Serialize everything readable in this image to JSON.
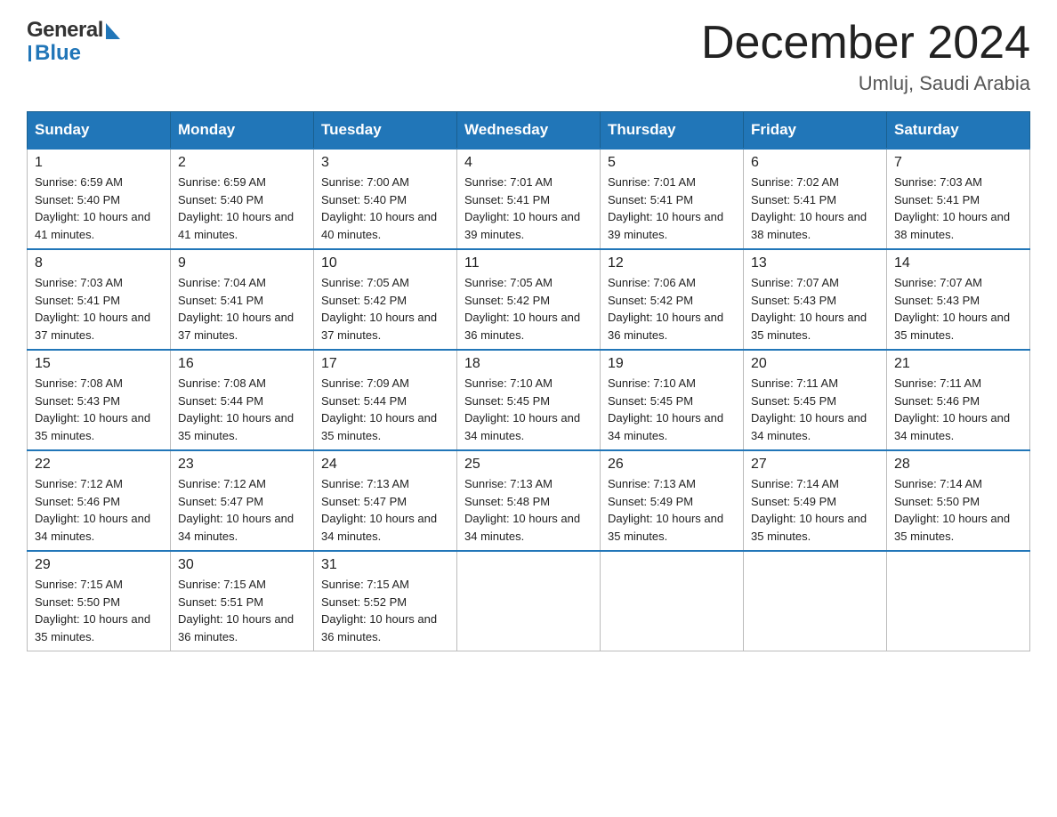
{
  "header": {
    "logo_general": "General",
    "logo_blue": "Blue",
    "month_title": "December 2024",
    "location": "Umluj, Saudi Arabia"
  },
  "days_of_week": [
    "Sunday",
    "Monday",
    "Tuesday",
    "Wednesday",
    "Thursday",
    "Friday",
    "Saturday"
  ],
  "weeks": [
    [
      {
        "day": "1",
        "sunrise": "6:59 AM",
        "sunset": "5:40 PM",
        "daylight": "10 hours and 41 minutes."
      },
      {
        "day": "2",
        "sunrise": "6:59 AM",
        "sunset": "5:40 PM",
        "daylight": "10 hours and 41 minutes."
      },
      {
        "day": "3",
        "sunrise": "7:00 AM",
        "sunset": "5:40 PM",
        "daylight": "10 hours and 40 minutes."
      },
      {
        "day": "4",
        "sunrise": "7:01 AM",
        "sunset": "5:41 PM",
        "daylight": "10 hours and 39 minutes."
      },
      {
        "day": "5",
        "sunrise": "7:01 AM",
        "sunset": "5:41 PM",
        "daylight": "10 hours and 39 minutes."
      },
      {
        "day": "6",
        "sunrise": "7:02 AM",
        "sunset": "5:41 PM",
        "daylight": "10 hours and 38 minutes."
      },
      {
        "day": "7",
        "sunrise": "7:03 AM",
        "sunset": "5:41 PM",
        "daylight": "10 hours and 38 minutes."
      }
    ],
    [
      {
        "day": "8",
        "sunrise": "7:03 AM",
        "sunset": "5:41 PM",
        "daylight": "10 hours and 37 minutes."
      },
      {
        "day": "9",
        "sunrise": "7:04 AM",
        "sunset": "5:41 PM",
        "daylight": "10 hours and 37 minutes."
      },
      {
        "day": "10",
        "sunrise": "7:05 AM",
        "sunset": "5:42 PM",
        "daylight": "10 hours and 37 minutes."
      },
      {
        "day": "11",
        "sunrise": "7:05 AM",
        "sunset": "5:42 PM",
        "daylight": "10 hours and 36 minutes."
      },
      {
        "day": "12",
        "sunrise": "7:06 AM",
        "sunset": "5:42 PM",
        "daylight": "10 hours and 36 minutes."
      },
      {
        "day": "13",
        "sunrise": "7:07 AM",
        "sunset": "5:43 PM",
        "daylight": "10 hours and 35 minutes."
      },
      {
        "day": "14",
        "sunrise": "7:07 AM",
        "sunset": "5:43 PM",
        "daylight": "10 hours and 35 minutes."
      }
    ],
    [
      {
        "day": "15",
        "sunrise": "7:08 AM",
        "sunset": "5:43 PM",
        "daylight": "10 hours and 35 minutes."
      },
      {
        "day": "16",
        "sunrise": "7:08 AM",
        "sunset": "5:44 PM",
        "daylight": "10 hours and 35 minutes."
      },
      {
        "day": "17",
        "sunrise": "7:09 AM",
        "sunset": "5:44 PM",
        "daylight": "10 hours and 35 minutes."
      },
      {
        "day": "18",
        "sunrise": "7:10 AM",
        "sunset": "5:45 PM",
        "daylight": "10 hours and 34 minutes."
      },
      {
        "day": "19",
        "sunrise": "7:10 AM",
        "sunset": "5:45 PM",
        "daylight": "10 hours and 34 minutes."
      },
      {
        "day": "20",
        "sunrise": "7:11 AM",
        "sunset": "5:45 PM",
        "daylight": "10 hours and 34 minutes."
      },
      {
        "day": "21",
        "sunrise": "7:11 AM",
        "sunset": "5:46 PM",
        "daylight": "10 hours and 34 minutes."
      }
    ],
    [
      {
        "day": "22",
        "sunrise": "7:12 AM",
        "sunset": "5:46 PM",
        "daylight": "10 hours and 34 minutes."
      },
      {
        "day": "23",
        "sunrise": "7:12 AM",
        "sunset": "5:47 PM",
        "daylight": "10 hours and 34 minutes."
      },
      {
        "day": "24",
        "sunrise": "7:13 AM",
        "sunset": "5:47 PM",
        "daylight": "10 hours and 34 minutes."
      },
      {
        "day": "25",
        "sunrise": "7:13 AM",
        "sunset": "5:48 PM",
        "daylight": "10 hours and 34 minutes."
      },
      {
        "day": "26",
        "sunrise": "7:13 AM",
        "sunset": "5:49 PM",
        "daylight": "10 hours and 35 minutes."
      },
      {
        "day": "27",
        "sunrise": "7:14 AM",
        "sunset": "5:49 PM",
        "daylight": "10 hours and 35 minutes."
      },
      {
        "day": "28",
        "sunrise": "7:14 AM",
        "sunset": "5:50 PM",
        "daylight": "10 hours and 35 minutes."
      }
    ],
    [
      {
        "day": "29",
        "sunrise": "7:15 AM",
        "sunset": "5:50 PM",
        "daylight": "10 hours and 35 minutes."
      },
      {
        "day": "30",
        "sunrise": "7:15 AM",
        "sunset": "5:51 PM",
        "daylight": "10 hours and 36 minutes."
      },
      {
        "day": "31",
        "sunrise": "7:15 AM",
        "sunset": "5:52 PM",
        "daylight": "10 hours and 36 minutes."
      },
      null,
      null,
      null,
      null
    ]
  ],
  "labels": {
    "sunrise_prefix": "Sunrise: ",
    "sunset_prefix": "Sunset: ",
    "daylight_prefix": "Daylight: "
  }
}
